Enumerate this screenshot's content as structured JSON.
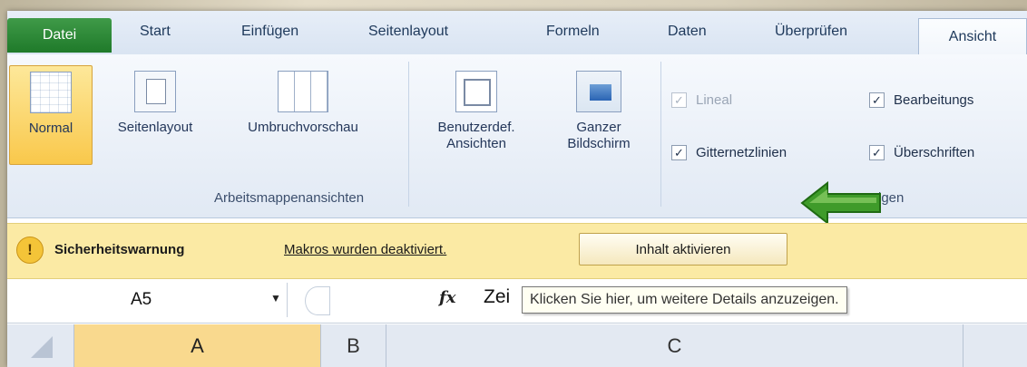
{
  "tabs": [
    {
      "label": "Datei"
    },
    {
      "label": "Start"
    },
    {
      "label": "Einfügen"
    },
    {
      "label": "Seitenlayout"
    },
    {
      "label": "Formeln"
    },
    {
      "label": "Daten"
    },
    {
      "label": "Überprüfen"
    },
    {
      "label": "Ansicht"
    }
  ],
  "ribbon": {
    "views": [
      {
        "label": "Normal"
      },
      {
        "label": "Seitenlayout"
      },
      {
        "label": "Umbruchvorschau"
      },
      {
        "label": "Benutzerdef.\nAnsichten"
      },
      {
        "label": "Ganzer\nBildschirm"
      }
    ],
    "group_views": "Arbeitsmappenansichten",
    "checkboxes": [
      {
        "label": "Lineal",
        "checked": true,
        "disabled": true
      },
      {
        "label": "Bearbeitungs",
        "checked": true,
        "disabled": false
      },
      {
        "label": "Gitternetzlinien",
        "checked": true,
        "disabled": false
      },
      {
        "label": "Überschriften",
        "checked": true,
        "disabled": false
      }
    ],
    "group_show_partial": "igen",
    "arrow_color": "#3f9b2a"
  },
  "warning": {
    "title": "Sicherheitswarnung",
    "message": "Makros wurden deaktiviert.",
    "button": "Inhalt aktivieren"
  },
  "formula_bar": {
    "name_box": "A5",
    "fx": "fx",
    "content": "Zei",
    "tooltip": "Klicken Sie hier, um weitere Details anzuzeigen."
  },
  "columns": [
    "A",
    "B",
    "C"
  ]
}
